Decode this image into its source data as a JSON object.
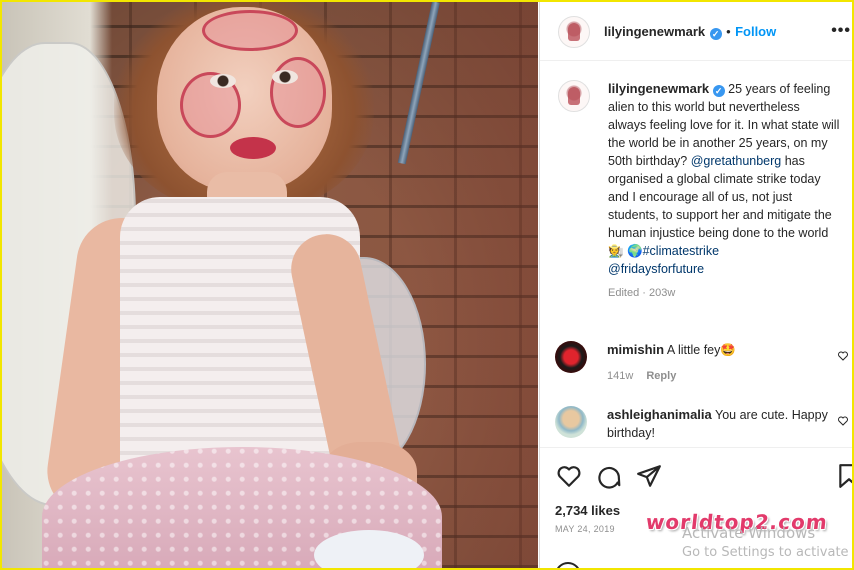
{
  "post": {
    "username": "lilyingenewmark",
    "verified_mark": "✓",
    "dot": "•",
    "follow_label": "Follow",
    "more_label": "•••"
  },
  "caption": {
    "username": "lilyingenewmark",
    "text_before_mention": "25 years of feeling alien to this world but nevertheless always feeling love for it. In what state will the world be in another 25 years, on my 50th birthday?",
    "mention": "@gretathunberg",
    "text_after_mention": "has organised a global climate strike today and I encourage all of us, not just students, to support her and mitigate the human injustice being done to the world",
    "emoji": "🧑‍🌾 🌍",
    "hashtag": "#climatestrike",
    "mention2": "@fridaysforfuture",
    "edited": "Edited",
    "age": "203w"
  },
  "comments": [
    {
      "username": "mimishin",
      "text": "A little fey",
      "emoji": "🤩",
      "age": "141w",
      "reply": "Reply"
    },
    {
      "username": "ashleighanimalia",
      "text": "You are cute. Happy birthday!"
    }
  ],
  "actions": {
    "likes": "2,734 likes",
    "date": "MAY 24, 2019"
  },
  "overlay": {
    "watermark": "worldtop2.com",
    "activate_line1": "Activate Windows",
    "activate_line2": "Go to Settings to activate"
  },
  "colors": {
    "accent": "#0095f6",
    "frame": "#f2e600",
    "watermark": "#e23a6b"
  }
}
